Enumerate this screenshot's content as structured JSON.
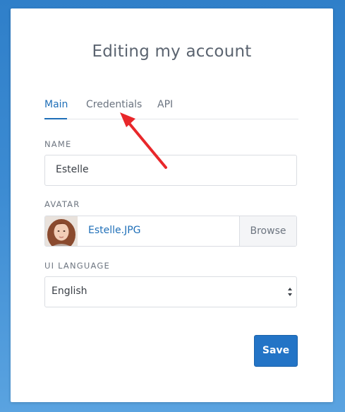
{
  "page": {
    "title": "Editing my account"
  },
  "tabs": [
    {
      "label": "Main",
      "active": true
    },
    {
      "label": "Credentials",
      "active": false
    },
    {
      "label": "API",
      "active": false
    }
  ],
  "fields": {
    "name": {
      "label": "NAME",
      "value": "Estelle"
    },
    "avatar": {
      "label": "AVATAR",
      "file_name": "Estelle.JPG",
      "browse_label": "Browse"
    },
    "ui_language": {
      "label": "UI LANGUAGE",
      "selected": "English"
    }
  },
  "actions": {
    "save_label": "Save"
  },
  "colors": {
    "accent": "#1f6fb8",
    "primary_button": "#2374c6",
    "annotation_arrow": "#e8272a"
  }
}
